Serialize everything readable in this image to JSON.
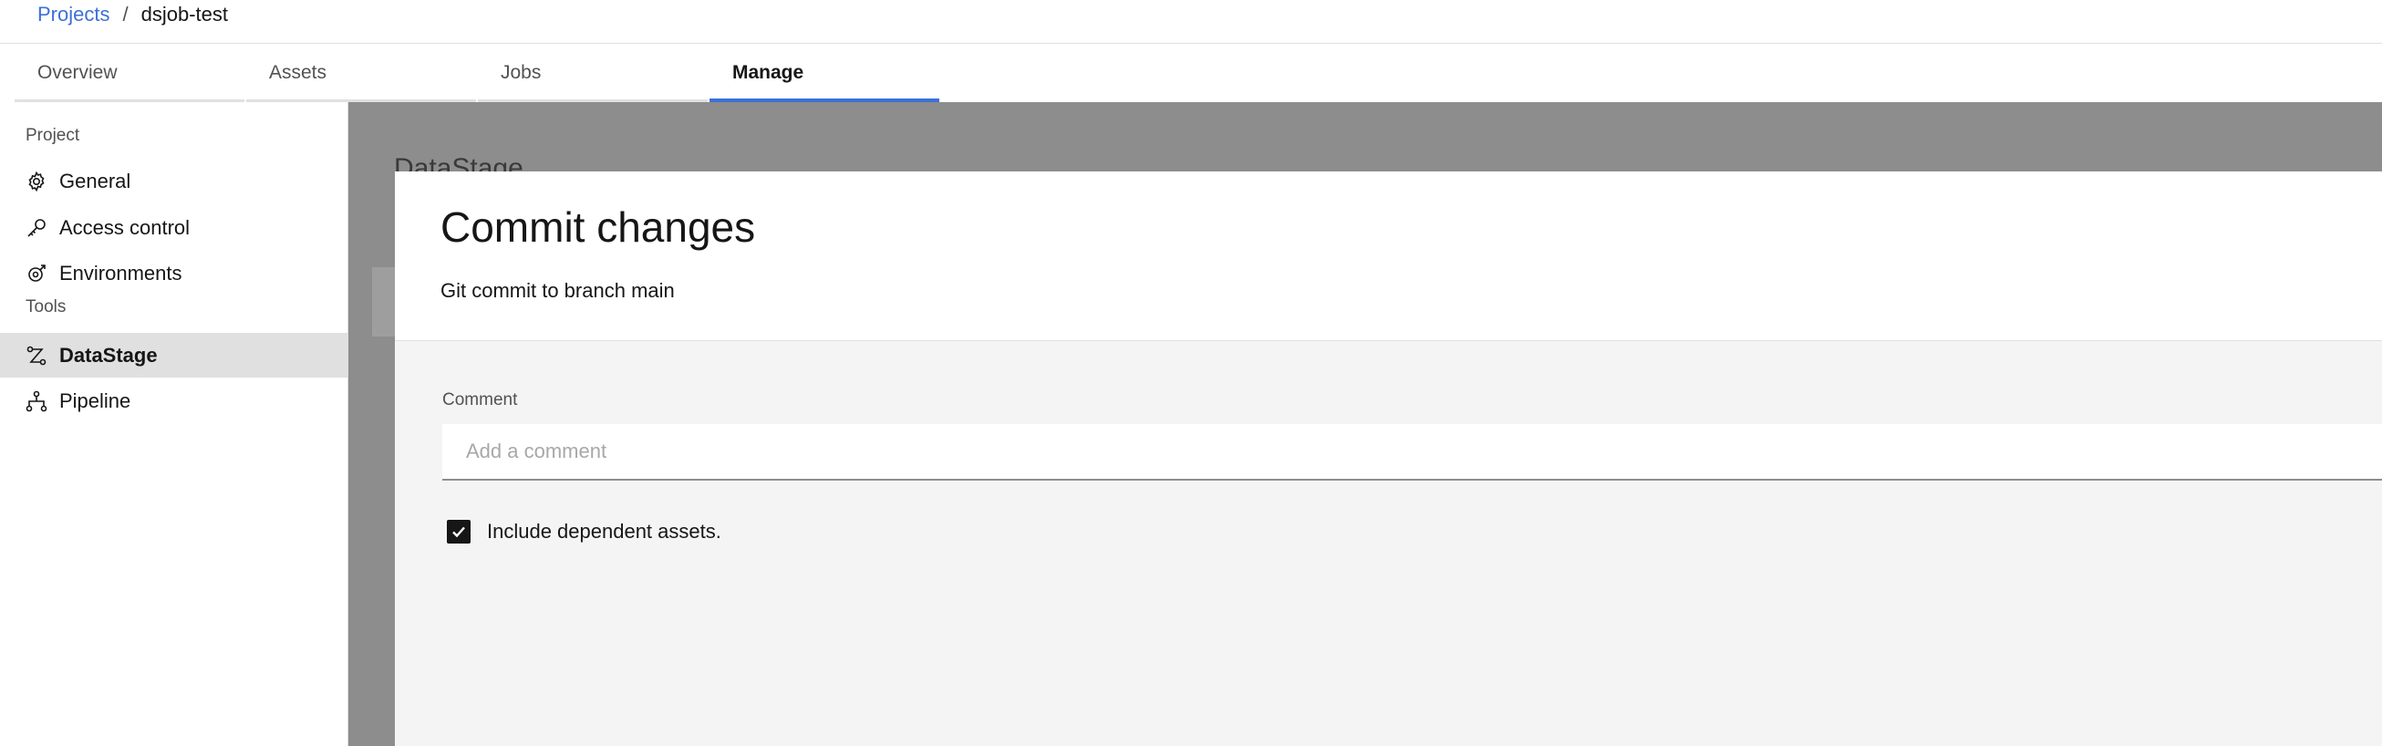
{
  "breadcrumb": {
    "projects_label": "Projects",
    "separator": "/",
    "current": "dsjob-test"
  },
  "tabs": [
    {
      "label": "Overview",
      "active": false
    },
    {
      "label": "Assets",
      "active": false
    },
    {
      "label": "Jobs",
      "active": false
    },
    {
      "label": "Manage",
      "active": true
    }
  ],
  "sidebar": {
    "project_section": "Project",
    "tools_section": "Tools",
    "items": [
      {
        "label": "General",
        "icon": "gear-icon"
      },
      {
        "label": "Access control",
        "icon": "key-icon"
      },
      {
        "label": "Environments",
        "icon": "environment-icon"
      },
      {
        "label": "DataStage",
        "icon": "datastage-icon",
        "selected": true
      },
      {
        "label": "Pipeline",
        "icon": "pipeline-icon"
      }
    ]
  },
  "background": {
    "title": "DataStage"
  },
  "modal": {
    "title": "Commit changes",
    "subtitle": "Git commit to branch main",
    "comment_label": "Comment",
    "comment_placeholder": "Add a comment",
    "comment_value": "",
    "checkbox_label": "Include dependent assets.",
    "checkbox_checked": true
  },
  "colors": {
    "accent": "#3d70d6",
    "backdrop": "#8d8d8d",
    "selected_item": "#e0e0e0"
  }
}
